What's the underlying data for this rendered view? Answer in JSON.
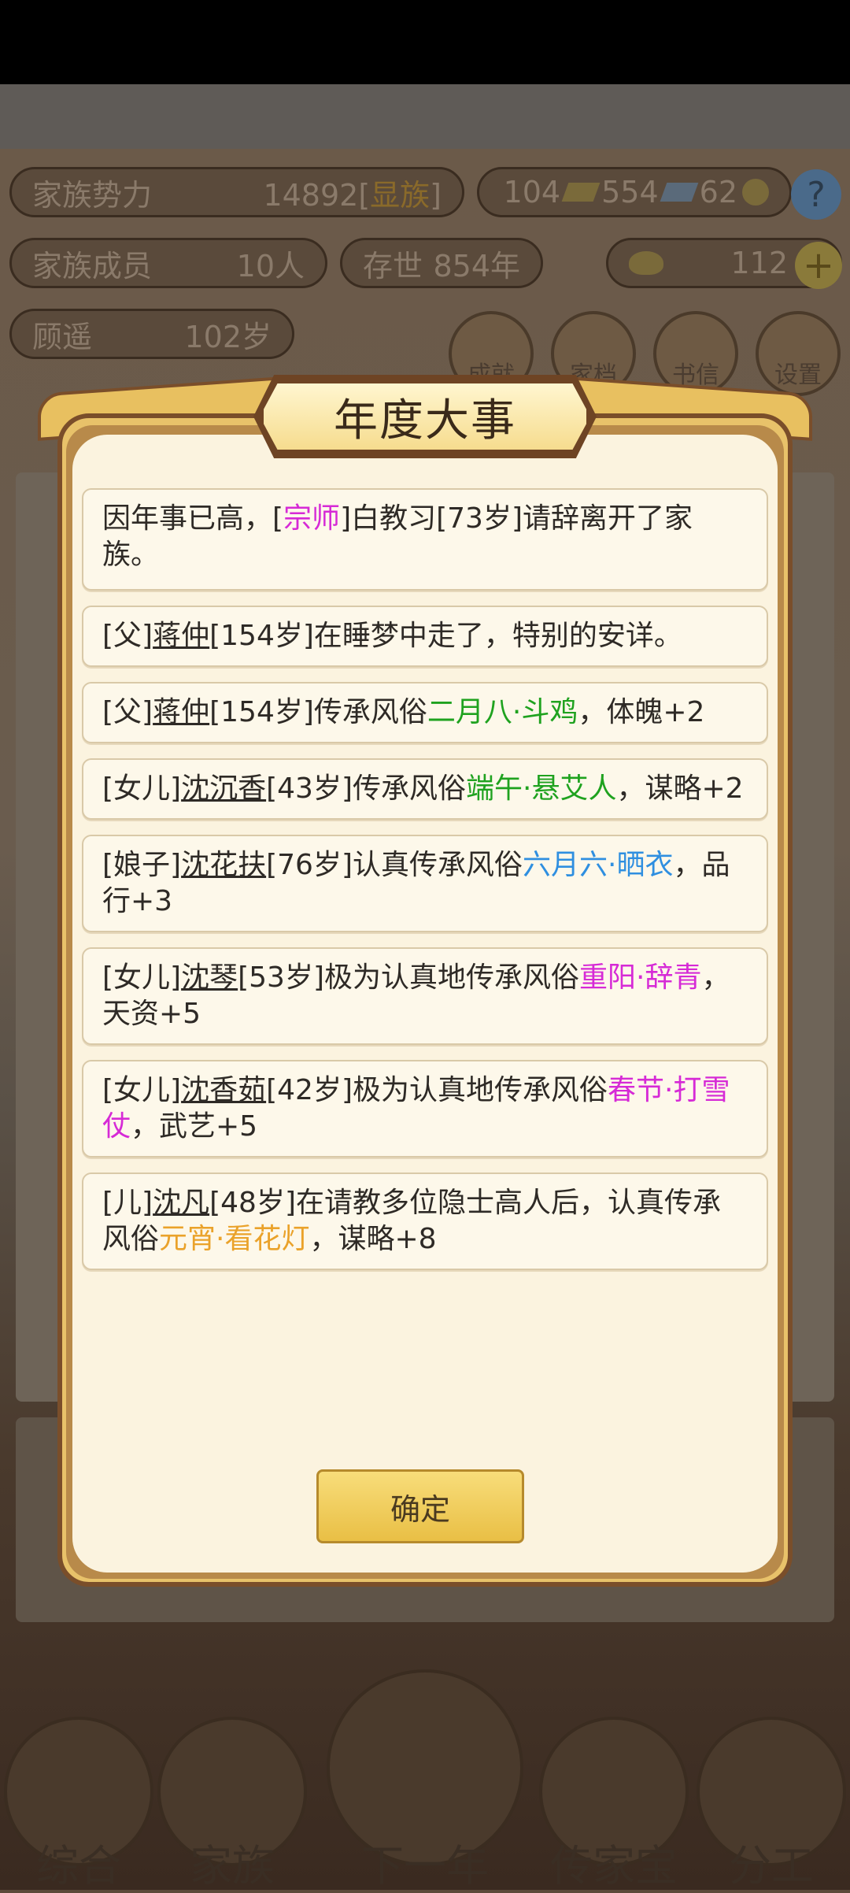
{
  "hud": {
    "clan_power_label": "家族势力",
    "clan_power_value": "14892",
    "clan_rank_open": "[",
    "clan_rank": "显族",
    "clan_rank_close": "]",
    "res1": "104",
    "res2": "554",
    "res3": "62",
    "help": "?",
    "members_label": "家族成员",
    "members_value": "10人",
    "alive_label": "存世",
    "alive_value": "854年",
    "gold_value": "112",
    "plus": "+",
    "elder_name": "顾遥",
    "elder_age": "102岁",
    "top_buttons": [
      "成就",
      "家档",
      "书信",
      "设置"
    ]
  },
  "dialog": {
    "title": "年度大事",
    "events": [
      {
        "p1": "因年事已高，[",
        "hl": "宗师",
        "p2": "]白教习[73岁]请辞离开了家族。"
      },
      {
        "pre": "[父]",
        "name": "蒋仲",
        "post": "[154岁]在睡梦中走了，特别的安详。"
      },
      {
        "pre": "[父]",
        "name": "蒋仲",
        "mid": "[154岁]传承风俗",
        "hl": "二月八·斗鸡",
        "post": "，体魄+2"
      },
      {
        "pre": "[女儿]",
        "name": "沈沉香",
        "mid": "[43岁]传承风俗",
        "hl": "端午·悬艾人",
        "post": "，谋略+2"
      },
      {
        "pre": "[娘子]",
        "name": "沈花扶",
        "mid": "[76岁]认真传承风俗",
        "hl": "六月六·晒衣",
        "post": "，品行+3"
      },
      {
        "pre": "[女儿]",
        "name": "沈琴",
        "mid": "[53岁]极为认真地传承风俗",
        "hl": "重阳·辞青",
        "post": "，天资+5"
      },
      {
        "pre": "[女儿]",
        "name": "沈香茹",
        "mid": "[42岁]极为认真地传承风俗",
        "hl": "春节·打雪仗",
        "post": "，武艺+5"
      },
      {
        "pre": "[儿]",
        "name": "沈凡",
        "mid": "[48岁]在请教多位隐士高人后，认真传承风俗",
        "hl": "元宵·看花灯",
        "post": "，谋略+8"
      }
    ],
    "confirm_label": "确定"
  },
  "nav": {
    "items": [
      "综合",
      "家族",
      "下一年",
      "传家宝",
      "分工"
    ]
  },
  "colors": {
    "magenta": "#d62ad6",
    "green": "#1fa21f",
    "blue": "#2f8fe0",
    "orange": "#eaa22a",
    "dialog_bg": "#fbf3df",
    "frame_gold": "#e8c26a"
  },
  "icons": [
    "gold-ingot-icon",
    "silver-ingot-icon",
    "coin-icon",
    "help-icon",
    "gold-yuanbao-icon",
    "plus-icon"
  ]
}
